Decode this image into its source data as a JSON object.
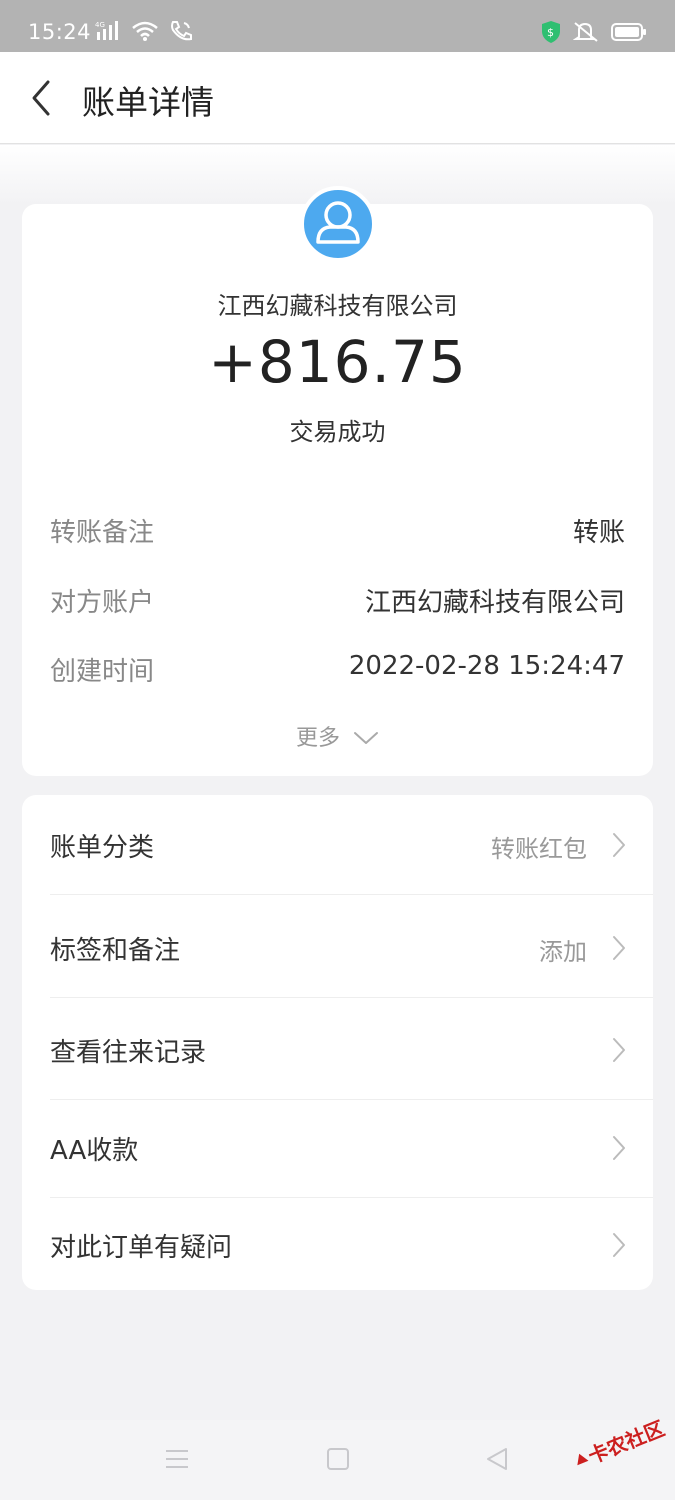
{
  "status_bar": {
    "time": "15:24",
    "network": "4G",
    "icons": [
      "signal-icon",
      "wifi-icon",
      "call-icon",
      "shield-icon",
      "mute-icon",
      "battery-icon"
    ]
  },
  "header": {
    "title": "账单详情",
    "back_icon": "chevron-left-icon"
  },
  "transaction": {
    "payer": "江西幻藏科技有限公司",
    "amount": "+816.75",
    "status": "交易成功",
    "avatar_icon": "user-avatar-icon"
  },
  "details": [
    {
      "label": "转账备注",
      "value": "转账"
    },
    {
      "label": "对方账户",
      "value": "江西幻藏科技有限公司"
    },
    {
      "label": "创建时间",
      "value": "2022-02-28 15:24:47"
    }
  ],
  "more_label": "更多",
  "menu": [
    {
      "label": "账单分类",
      "value": "转账红包"
    },
    {
      "label": "标签和备注",
      "value": "添加"
    },
    {
      "label": "查看往来记录",
      "value": ""
    },
    {
      "label": "AA收款",
      "value": ""
    },
    {
      "label": "对此订单有疑问",
      "value": ""
    }
  ],
  "watermark": "卡农社区",
  "colors": {
    "avatar": "#4da9ef",
    "page_bg": "#f2f2f4",
    "status_bar": "#b3b3b3",
    "watermark": "#cc1f1f"
  }
}
